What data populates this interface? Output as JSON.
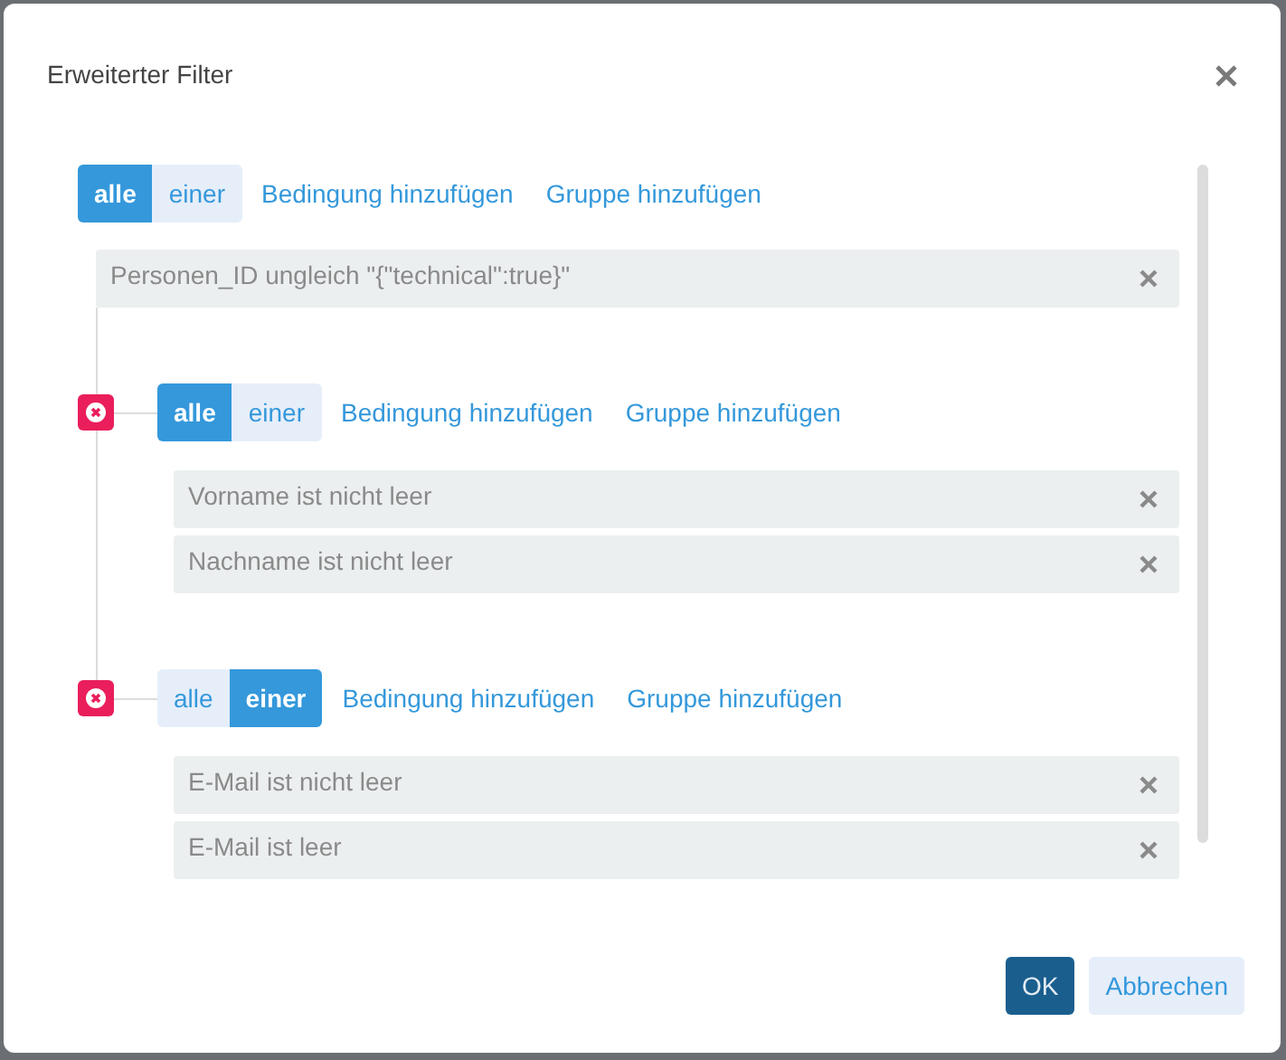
{
  "dialog": {
    "title": "Erweiterter Filter"
  },
  "root": {
    "modes": [
      {
        "label": "alle",
        "selected": true
      },
      {
        "label": "einer",
        "selected": false
      }
    ],
    "actions": [
      "Bedingung hinzufügen",
      "Gruppe hinzufügen"
    ],
    "rules": [
      "Personen_ID ungleich \"{\"technical\":true}\""
    ],
    "groups": [
      {
        "modes": [
          {
            "label": "alle",
            "selected": true
          },
          {
            "label": "einer",
            "selected": false
          }
        ],
        "actions": [
          "Bedingung hinzufügen",
          "Gruppe hinzufügen"
        ],
        "rules": [
          "Vorname ist nicht leer",
          "Nachname ist nicht leer"
        ]
      },
      {
        "modes": [
          {
            "label": "alle",
            "selected": false
          },
          {
            "label": "einer",
            "selected": true
          }
        ],
        "actions": [
          "Bedingung hinzufügen",
          "Gruppe hinzufügen"
        ],
        "rules": [
          "E-Mail ist nicht leer",
          "E-Mail ist leer"
        ]
      }
    ]
  },
  "buttons": [
    {
      "label": "OK",
      "kind": "primary"
    },
    {
      "label": "Abbrechen",
      "kind": "secondary"
    }
  ]
}
